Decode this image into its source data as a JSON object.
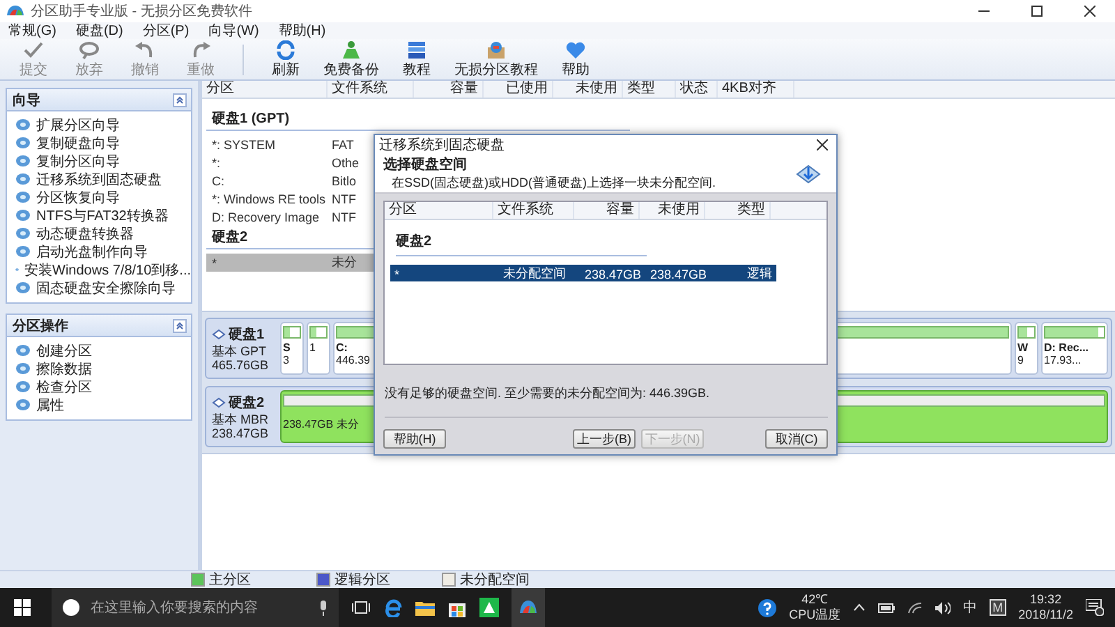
{
  "window": {
    "title": "分区助手专业版 - 无损分区免费软件"
  },
  "menu": [
    "常规(G)",
    "硬盘(D)",
    "分区(P)",
    "向导(W)",
    "帮助(H)"
  ],
  "toolbar_edit": [
    {
      "label": "提交",
      "kind": "check",
      "disabled": true
    },
    {
      "label": "放弃",
      "kind": "discard",
      "disabled": true
    },
    {
      "label": "撤销",
      "kind": "undo",
      "disabled": true
    },
    {
      "label": "重做",
      "kind": "redo",
      "disabled": true
    }
  ],
  "toolbar_tools": [
    {
      "label": "刷新",
      "kind": "refresh",
      "disabled": false
    },
    {
      "label": "免费备份",
      "kind": "backup",
      "disabled": false
    },
    {
      "label": "教程",
      "kind": "tutorial",
      "disabled": false
    },
    {
      "label": "无损分区教程",
      "kind": "guide",
      "disabled": false
    },
    {
      "label": "帮助",
      "kind": "help",
      "disabled": false
    }
  ],
  "sidebar": [
    {
      "title": "向导",
      "items": [
        "扩展分区向导",
        "复制硬盘向导",
        "复制分区向导",
        "迁移系统到固态硬盘",
        "分区恢复向导",
        "NTFS与FAT32转换器",
        "动态硬盘转换器",
        "启动光盘制作向导",
        "安装Windows 7/8/10到移...",
        "固态硬盘安全擦除向导"
      ]
    },
    {
      "title": "分区操作",
      "items": [
        "创建分区",
        "擦除数据",
        "检查分区",
        "属性"
      ]
    }
  ],
  "table": {
    "columns": [
      "分区",
      "文件系统",
      "容量",
      "已使用",
      "未使用",
      "类型",
      "状态",
      "4KB对齐"
    ],
    "disks": [
      {
        "title": "硬盘1 (GPT)",
        "rows": [
          {
            "partition": "*: SYSTEM",
            "file_system": "FAT",
            "selected": false
          },
          {
            "partition": "*:",
            "file_system": "Othe",
            "selected": false
          },
          {
            "partition": "C:",
            "file_system": "Bitlo",
            "selected": false
          },
          {
            "partition": "*: Windows RE tools",
            "file_system": "NTF",
            "selected": false
          },
          {
            "partition": "D: Recovery Image",
            "file_system": "NTF",
            "selected": false
          }
        ]
      },
      {
        "title": "硬盘2",
        "rows": [
          {
            "partition": "*",
            "file_system": "未分",
            "selected": true
          }
        ]
      }
    ]
  },
  "disk_map": [
    {
      "name": "硬盘1",
      "type": "基本 GPT",
      "size": "465.76GB",
      "partitions": [
        {
          "kind": "primary",
          "label": "S",
          "detail": "3",
          "level": 0.4
        },
        {
          "kind": "primary",
          "detail": "1",
          "level": 0.4
        },
        {
          "kind": "primary",
          "label": "C:",
          "detail": "446.39",
          "level": 1
        },
        {
          "kind": "primary",
          "label": "W",
          "detail": "9",
          "level": 0.5
        },
        {
          "kind": "primary",
          "label": "D: Rec...",
          "detail": "17.93...",
          "level": 0.9
        }
      ]
    },
    {
      "name": "硬盘2",
      "type": "基本 MBR",
      "size": "238.47GB",
      "partitions": [
        {
          "kind": "unallocated",
          "label": "238.47GB 未分",
          "selected": true
        }
      ]
    }
  ],
  "legend": [
    {
      "label": "主分区",
      "color": "#5cc45a"
    },
    {
      "label": "逻辑分区",
      "color": "#4b57c8"
    },
    {
      "label": "未分配空间",
      "color": "#efece4"
    }
  ],
  "dialog": {
    "title": "迁移系统到固态硬盘",
    "heading": "选择硬盘空间",
    "subtitle": "在SSD(固态硬盘)或HDD(普通硬盘)上选择一块未分配空间.",
    "columns": [
      "分区",
      "文件系统",
      "容量",
      "未使用",
      "类型"
    ],
    "disk": "硬盘2",
    "rows": [
      {
        "cells": [
          "*",
          "未分配空间",
          "238.47GB",
          "238.47GB",
          "逻辑"
        ],
        "selected": true
      }
    ],
    "message": "没有足够的硬盘空间. 至少需要的未分配空间为: 446.39GB.",
    "buttons": [
      {
        "label": "帮助(H)",
        "disabled": false
      },
      {
        "label": "上一步(B)",
        "disabled": false
      },
      {
        "label": "下一步(N)",
        "disabled": true
      },
      {
        "label": "取消(C)",
        "disabled": false
      }
    ]
  },
  "taskbar": {
    "search_placeholder": "在这里输入你要搜索的内容",
    "temperature": "42℃",
    "sensor": "CPU温度",
    "ime": "中",
    "ime_mode": "M",
    "time": "19:32",
    "date": "2018/11/2"
  }
}
